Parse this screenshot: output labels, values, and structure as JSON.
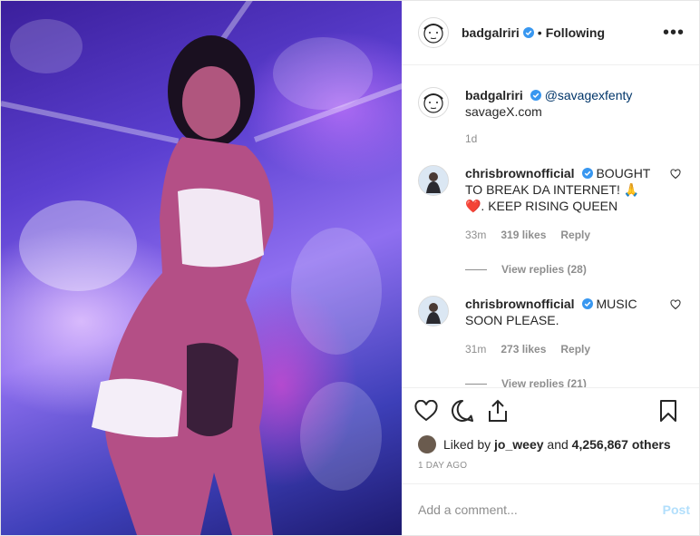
{
  "post": {
    "author": "badgalriri",
    "follow_dot": "•",
    "follow_status": "Following",
    "more_icon": "more-options-icon",
    "colors": {
      "link": "#003569",
      "verified": "#3897f0",
      "muted": "#8e8e8e",
      "post_button": "#b2dffc"
    }
  },
  "caption": {
    "username": "badgalriri",
    "mention": "@savagexfenty",
    "text": "savageX.com",
    "age": "1d"
  },
  "comments": [
    {
      "username": "chrisbrownofficial",
      "text": "BOUGHT TO BREAK DA INTERNET! 🙏❤️. KEEP RISING QUEEN",
      "age": "33m",
      "likes": "319 likes",
      "reply": "Reply",
      "view_replies": "View replies (28)"
    },
    {
      "username": "chrisbrownofficial",
      "text": "MUSIC SOON PLEASE.",
      "age": "31m",
      "likes": "273 likes",
      "reply": "Reply",
      "view_replies": "View replies (21)"
    }
  ],
  "likes": {
    "prefix": "Liked by",
    "user": "jo_weey",
    "and": "and",
    "others": "4,256,867 others"
  },
  "timestamp": "1 DAY AGO",
  "add_comment": {
    "placeholder": "Add a comment...",
    "post_label": "Post"
  }
}
